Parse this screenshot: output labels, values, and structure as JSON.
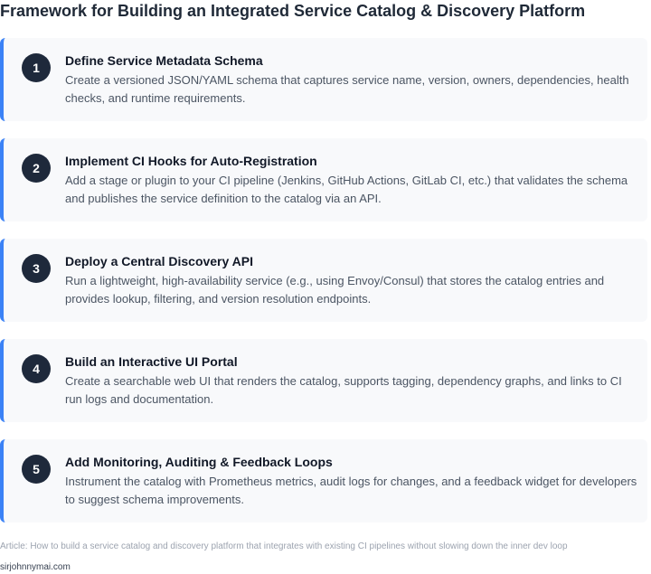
{
  "header": {
    "title": "Framework for Building an Integrated Service Catalog & Discovery Platform"
  },
  "steps": [
    {
      "number": "1",
      "title": "Define Service Metadata Schema",
      "description": "Create a versioned JSON/YAML schema that captures service name, version, owners, dependencies, health checks, and runtime requirements."
    },
    {
      "number": "2",
      "title": "Implement CI Hooks for Auto-Registration",
      "description": "Add a stage or plugin to your CI pipeline (Jenkins, GitHub Actions, GitLab CI, etc.) that validates the schema and publishes the service definition to the catalog via an API."
    },
    {
      "number": "3",
      "title": "Deploy a Central Discovery API",
      "description": "Run a lightweight, high-availability service (e.g., using Envoy/Consul) that stores the catalog entries and provides lookup, filtering, and version resolution endpoints."
    },
    {
      "number": "4",
      "title": "Build an Interactive UI Portal",
      "description": "Create a searchable web UI that renders the catalog, supports tagging, dependency graphs, and links to CI run logs and documentation."
    },
    {
      "number": "5",
      "title": "Add Monitoring, Auditing & Feedback Loops",
      "description": "Instrument the catalog with Prometheus metrics, audit logs for changes, and a feedback widget for developers to suggest schema improvements."
    }
  ],
  "footer": {
    "article": "Article: How to build a service catalog and discovery platform that integrates with existing CI pipelines without slowing down the inner dev loop",
    "site": "sirjohnnymai.com"
  },
  "colors": {
    "accent": "#3b82f6",
    "badge": "#1e293b",
    "card_background": "#f8f9fb"
  }
}
